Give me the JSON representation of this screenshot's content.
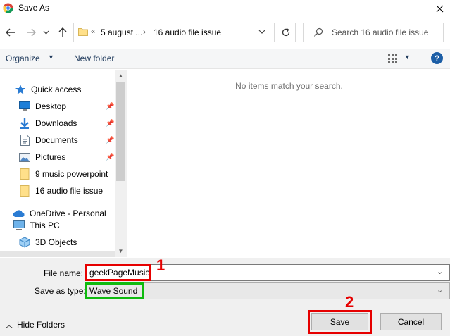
{
  "window": {
    "title": "Save As"
  },
  "address": {
    "chevrons": "«",
    "crumbs": [
      "5 august ...",
      "16 audio file issue"
    ],
    "separator": "›"
  },
  "search": {
    "placeholder": "Search 16 audio file issue"
  },
  "toolbar": {
    "organize": "Organize",
    "new_folder": "New folder",
    "help": "?"
  },
  "navigation": {
    "quick_access": "Quick access",
    "items": [
      {
        "label": "Desktop",
        "icon": "desktop-icon",
        "pinned": true
      },
      {
        "label": "Downloads",
        "icon": "downloads-icon",
        "pinned": true
      },
      {
        "label": "Documents",
        "icon": "documents-icon",
        "pinned": true
      },
      {
        "label": "Pictures",
        "icon": "pictures-icon",
        "pinned": true
      },
      {
        "label": "9 music powerpoint",
        "icon": "folder-icon",
        "pinned": false
      },
      {
        "label": "16 audio file issue",
        "icon": "folder-icon",
        "pinned": false
      }
    ],
    "onedrive": "OneDrive - Personal",
    "this_pc": "This PC",
    "objects": "3D Objects"
  },
  "main": {
    "empty_message": "No items match your search."
  },
  "form": {
    "filename_label": "File name:",
    "filename_value": "geekPageMusic",
    "type_label": "Save as type:",
    "type_value": "Wave Sound"
  },
  "annotations": {
    "step1": "1",
    "step2": "2"
  },
  "footer": {
    "hide_folders": "Hide Folders",
    "save": "Save",
    "cancel": "Cancel"
  },
  "colors": {
    "accent": "#1c5ea6",
    "annotation_red": "#e60000",
    "annotation_green": "#0fba0f"
  }
}
